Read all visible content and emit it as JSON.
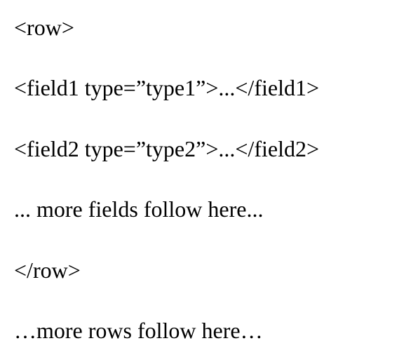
{
  "lines": {
    "l1": "<row>",
    "l2": "<field1 type=”type1”>...</field1>",
    "l3": "<field2 type=”type2”>...</field2>",
    "l4": "... more fields follow here...",
    "l5": "</row>",
    "l6": "…more rows follow here…"
  }
}
